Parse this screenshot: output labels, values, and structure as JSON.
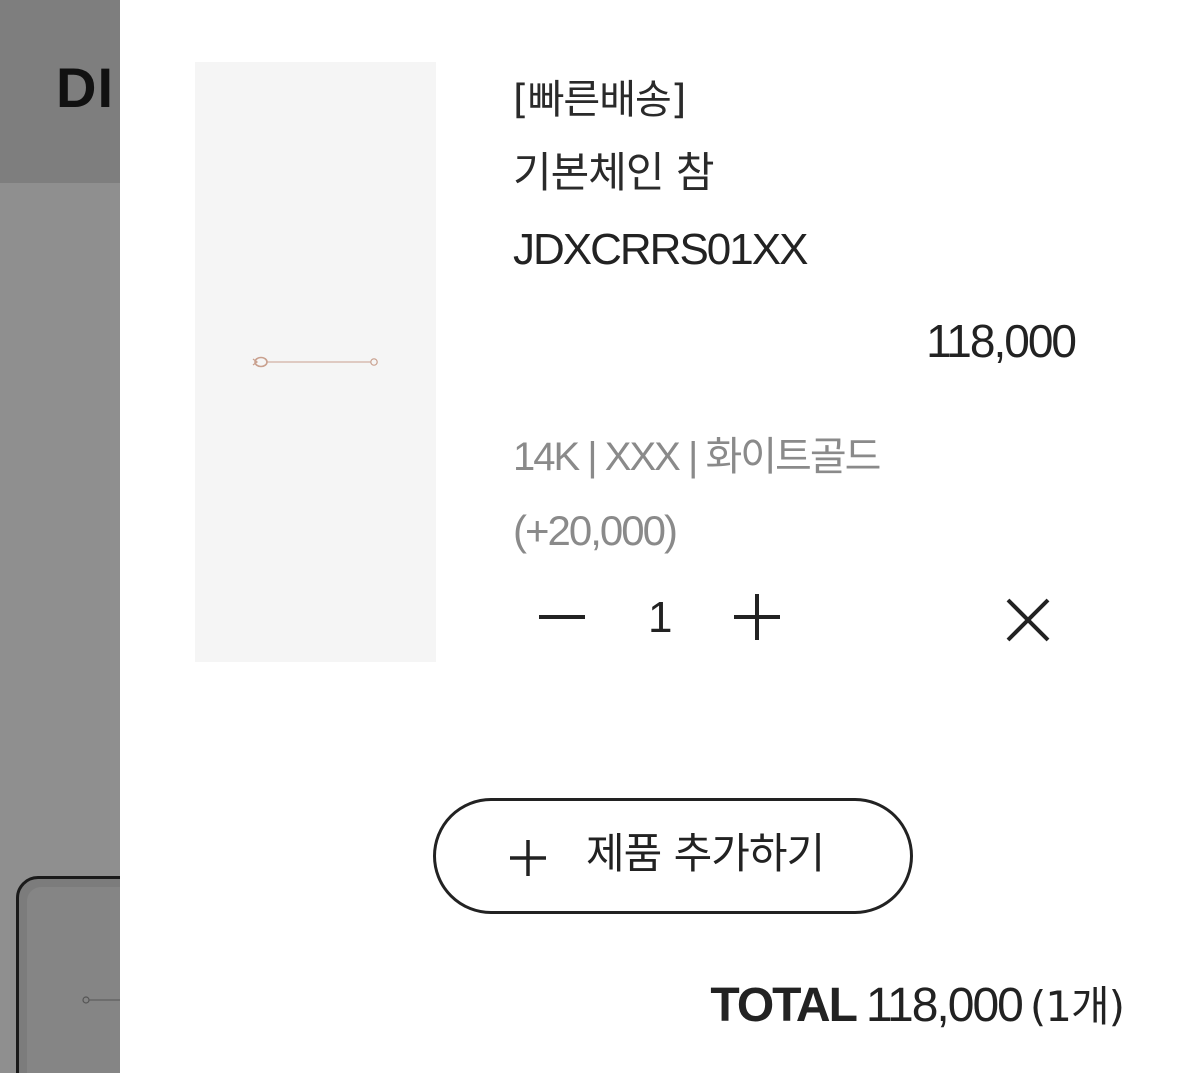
{
  "background": {
    "logo_text": "DI"
  },
  "cart_item": {
    "tag": "[빠른배송]",
    "name": "기본체인 참",
    "code": "JDXCRRS01XX",
    "price": "118,000",
    "option": "14K | XXX | 화이트골드",
    "option_price": "(+20,000)",
    "quantity": "1",
    "image_icon": "chain-charm-image"
  },
  "add_button": {
    "label": "제품 추가하기",
    "icon": "plus-icon"
  },
  "total": {
    "label": "TOTAL",
    "amount": "118,000",
    "count": "(1개)"
  },
  "colors": {
    "overlay": "#8f8f8f",
    "thumb_bg": "#f5f5f5",
    "chain": "#c9a08e",
    "text": "#222222",
    "muted": "#8a8a8a"
  }
}
